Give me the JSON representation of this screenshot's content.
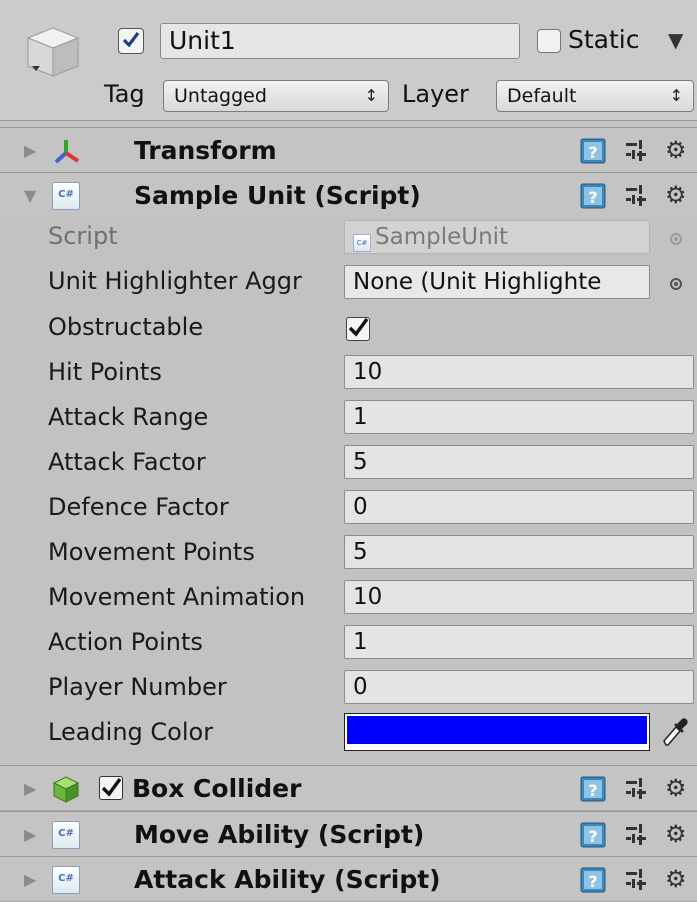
{
  "header": {
    "object_name": "Unit1",
    "active_checked": true,
    "static_label": "Static",
    "static_checked": false,
    "tag_label": "Tag",
    "tag_value": "Untagged",
    "layer_label": "Layer",
    "layer_value": "Default"
  },
  "components": {
    "transform": {
      "title": "Transform",
      "expanded": false
    },
    "sample_unit": {
      "title": "Sample Unit (Script)",
      "expanded": true
    },
    "box_collider": {
      "title": "Box Collider",
      "expanded": false,
      "enabled": true
    },
    "move_ability": {
      "title": "Move Ability (Script)",
      "expanded": false
    },
    "attack_ability": {
      "title": "Attack Ability (Script)",
      "expanded": false
    }
  },
  "sample_unit": {
    "script": {
      "label": "Script",
      "value": "SampleUnit"
    },
    "unit_highlighter": {
      "label": "Unit Highlighter Aggr",
      "value": "None (Unit Highlighte"
    },
    "obstructable": {
      "label": "Obstructable",
      "checked": true
    },
    "hit_points": {
      "label": "Hit Points",
      "value": "10"
    },
    "attack_range": {
      "label": "Attack Range",
      "value": "1"
    },
    "attack_factor": {
      "label": "Attack Factor",
      "value": "5"
    },
    "defence_factor": {
      "label": "Defence Factor",
      "value": "0"
    },
    "movement_points": {
      "label": "Movement Points",
      "value": "5"
    },
    "movement_animation": {
      "label": "Movement Animation",
      "value": "10"
    },
    "action_points": {
      "label": "Action Points",
      "value": "1"
    },
    "player_number": {
      "label": "Player Number",
      "value": "0"
    },
    "leading_color": {
      "label": "Leading Color",
      "color": "#0000ff"
    }
  },
  "icons": {
    "cs_script": "C#"
  }
}
